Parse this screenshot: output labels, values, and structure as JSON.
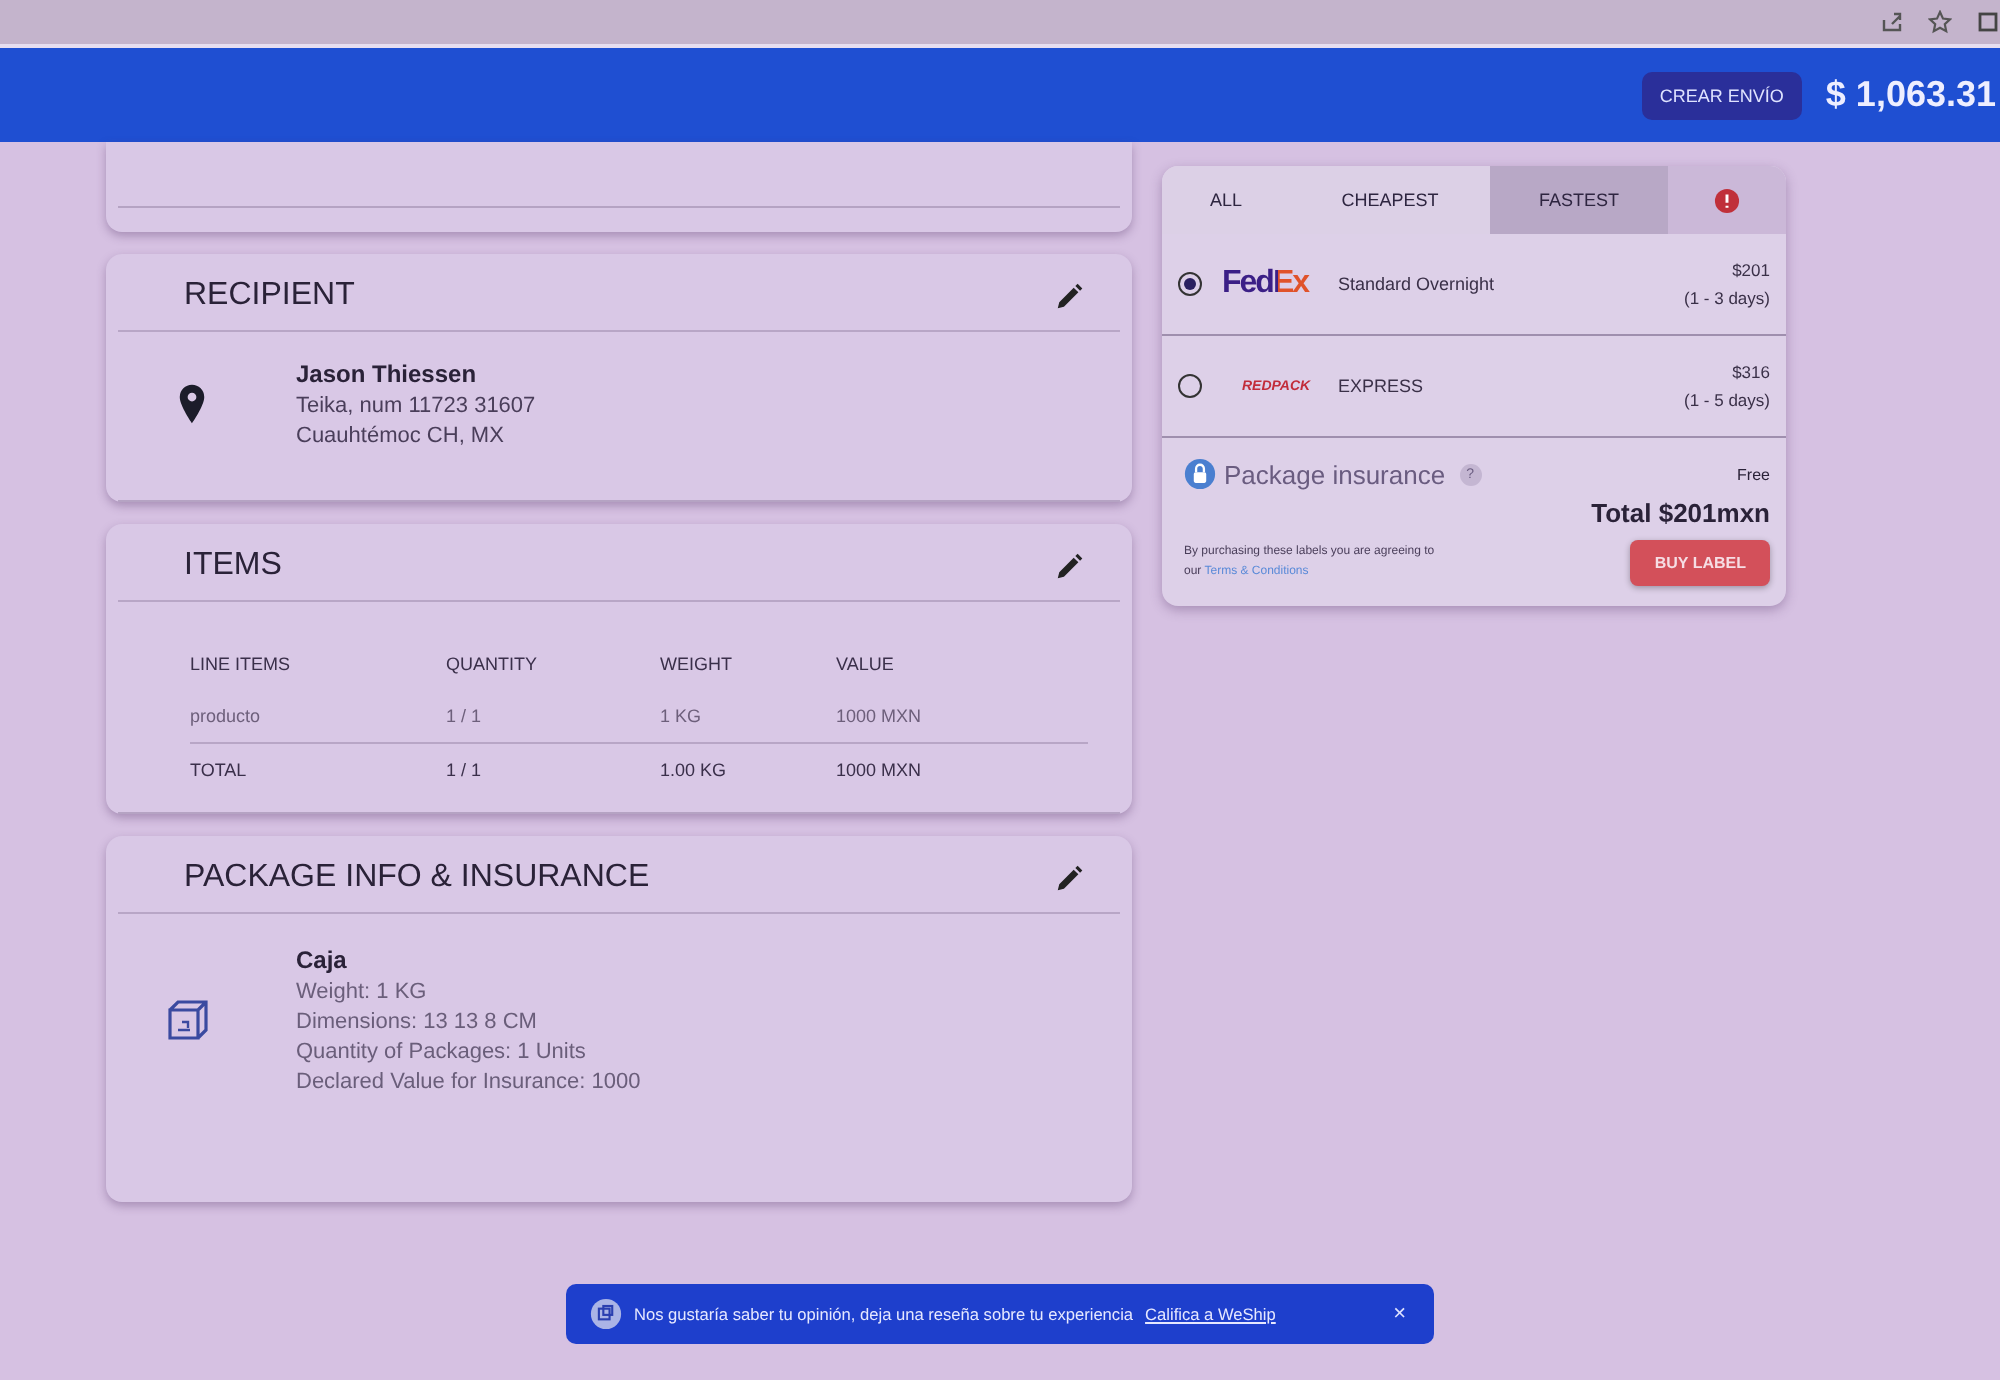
{
  "header": {
    "create_button": "CREAR ENVÍO",
    "balance": "$ 1,063.31"
  },
  "recipient": {
    "title": "RECIPIENT",
    "name": "Jason Thiessen",
    "address_lines": [
      "Teika, num 11723 31607",
      "Cuauhtémoc CH, MX"
    ]
  },
  "items": {
    "title": "ITEMS",
    "columns": [
      "LINE ITEMS",
      "QUANTITY",
      "WEIGHT",
      "VALUE"
    ],
    "rows": [
      {
        "kind": "item",
        "cells": [
          "producto",
          "1 / 1",
          "1 KG",
          "1000 MXN"
        ]
      },
      {
        "kind": "total",
        "cells": [
          "TOTAL",
          "1 / 1",
          "1.00 KG",
          "1000 MXN"
        ]
      }
    ]
  },
  "package": {
    "title": "PACKAGE INFO & INSURANCE",
    "name": "Caja",
    "lines": [
      "Weight: 1 KG",
      "Dimensions: 13 13 8 CM",
      "Quantity of Packages: 1 Units",
      "Declared Value for Insurance: 1000"
    ]
  },
  "rates": {
    "tabs": [
      {
        "label": "ALL",
        "selected": false
      },
      {
        "label": "CHEAPEST",
        "selected": false
      },
      {
        "label": "FASTEST",
        "selected": true
      }
    ],
    "options": [
      {
        "logo": "FedEx",
        "kind": "fedex",
        "service": "Standard Overnight",
        "price": "$201",
        "days": "(1 - 3 days)",
        "selected": true
      },
      {
        "logo": "REDPACK",
        "kind": "redpack",
        "service": "EXPRESS",
        "price": "$316",
        "days": "(1 - 5 days)",
        "selected": false
      }
    ],
    "insurance_label": "Package insurance",
    "help": "?",
    "insurance_price": "Free",
    "total": "Total $201mxn",
    "terms_text": "By purchasing these labels you are agreeing to our",
    "terms_link": "Terms & Conditions",
    "buy_button": "BUY LABEL"
  },
  "toast": {
    "text": "Nos gustaría saber tu opinión, deja una reseña sobre tu experiencia",
    "link": "Califica a WeShip",
    "close": "×"
  }
}
